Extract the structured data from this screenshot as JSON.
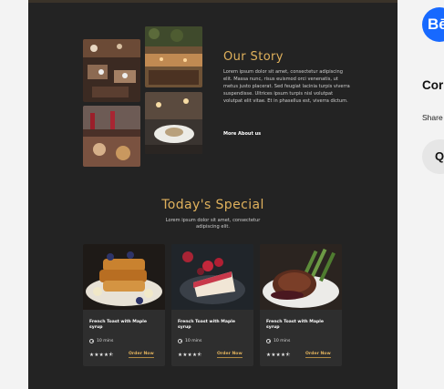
{
  "story": {
    "title": "Our Story",
    "body": "Lorem ipsum dolor sit amet, consectetur adipiscing elit. Massa nunc, risus euismod orci venenatis, ut metus justo placerat. Sed feugiat lacinia turpis viverra suspendisse. Ultrices ipsum turpis nisl volutpat volutpat elit vitae. Et in phasellus est, viverra dictum.",
    "link": "More About us"
  },
  "special": {
    "title": "Today's Special",
    "subtitle": "Lorem ipsum dolor sit amet, consectetur adipiscing elit."
  },
  "cards": [
    {
      "name": "French Toast with Maple syrup",
      "time": "10 mins",
      "stars": "★★★★⯪",
      "order": "Order Now"
    },
    {
      "name": "French Toast with Maple syrup",
      "time": "10 mins",
      "stars": "★★★★⯪",
      "order": "Order Now"
    },
    {
      "name": "French Toast with Maple syrup",
      "time": "10 mins",
      "stars": "★★★★⯪",
      "order": "Order Now"
    }
  ],
  "sidebar": {
    "logo": "Bē",
    "title": "Cor",
    "share": "Share",
    "button": "Q"
  },
  "colors": {
    "panel": "#232323",
    "accent": "#e0b15c",
    "behance": "#1769ff"
  }
}
